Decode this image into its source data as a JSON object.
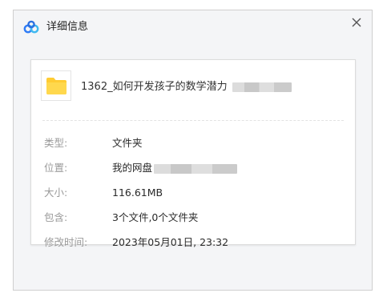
{
  "dialog": {
    "title": "详细信息",
    "close_symbol": "×",
    "icon": "baidu-netdisk-logo-icon"
  },
  "file": {
    "icon": "folder-icon",
    "name": "1362_如何开发孩子的数学潜力"
  },
  "details": [
    {
      "label": "类型:",
      "value": "文件夹"
    },
    {
      "label": "位置:",
      "value": "我的网盘"
    },
    {
      "label": "大小:",
      "value": "116.61MB"
    },
    {
      "label": "包含:",
      "value": "3个文件,0个文件夹"
    },
    {
      "label": "修改时间:",
      "value": "2023年05月01日, 23:32"
    }
  ],
  "colors": {
    "folder": "#ffcc33",
    "logo_blue": "#2f7cf6",
    "logo_cyan": "#3fb9f0"
  }
}
